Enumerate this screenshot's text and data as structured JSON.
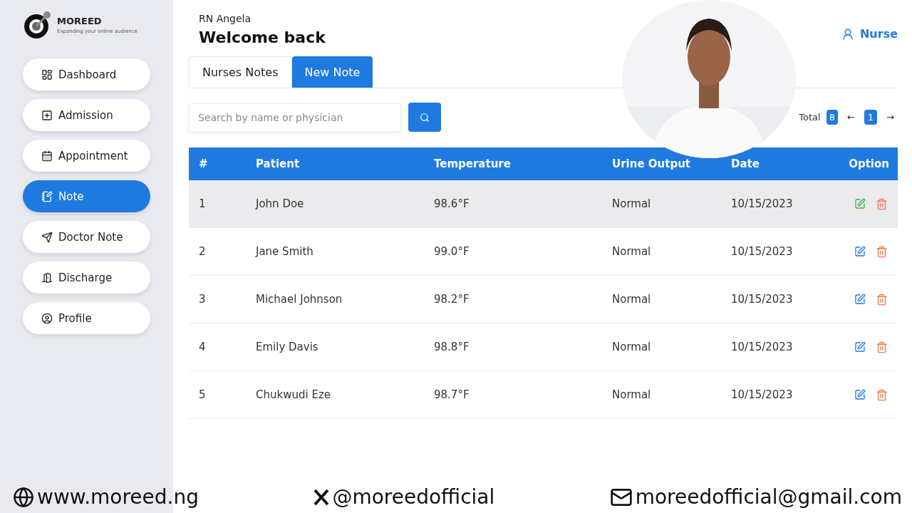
{
  "brand": {
    "name": "MOREED",
    "tagline": "Expanding your online audience"
  },
  "nav": [
    {
      "label": "Dashboard",
      "kind": "dashboard",
      "selected": false
    },
    {
      "label": "Admission",
      "kind": "admission",
      "selected": false
    },
    {
      "label": "Appointment",
      "kind": "calendar",
      "selected": false
    },
    {
      "label": "Note",
      "kind": "note",
      "selected": true
    },
    {
      "label": "Doctor Note",
      "kind": "send",
      "selected": false
    },
    {
      "label": "Discharge",
      "kind": "door",
      "selected": false
    },
    {
      "label": "Profile",
      "kind": "user",
      "selected": false
    }
  ],
  "header": {
    "user": "RN Angela",
    "greeting": "Welcome back",
    "role": "Nurse"
  },
  "tabs": [
    {
      "label": "Nurses Notes",
      "selected": false
    },
    {
      "label": "New Note",
      "selected": true
    }
  ],
  "search": {
    "placeholder": "Search by name or physician"
  },
  "pagination": {
    "label": "Total",
    "total": "8",
    "prev": "←",
    "page": "1",
    "next": "→"
  },
  "table": {
    "columns": [
      "#",
      "Patient",
      "Temperature",
      "Urine Output",
      "Date",
      "Option"
    ],
    "rows": [
      {
        "cells": [
          "1",
          "John Doe",
          "98.6°F",
          "Normal",
          "10/15/2023"
        ],
        "highlighted": true
      },
      {
        "cells": [
          "2",
          "Jane Smith",
          "99.0°F",
          "Normal",
          "10/15/2023"
        ],
        "highlighted": false
      },
      {
        "cells": [
          "3",
          "Michael Johnson",
          "98.2°F",
          "Normal",
          "10/15/2023"
        ],
        "highlighted": false
      },
      {
        "cells": [
          "4",
          "Emily Davis",
          "98.8°F",
          "Normal",
          "10/15/2023"
        ],
        "highlighted": false
      },
      {
        "cells": [
          "5",
          "Chukwudi Eze",
          "98.7°F",
          "Normal",
          "10/15/2023"
        ],
        "highlighted": false
      }
    ]
  },
  "footer": [
    {
      "kind": "web",
      "text": "www.moreed.ng"
    },
    {
      "kind": "x",
      "text": "@moreedofficial"
    },
    {
      "kind": "mail",
      "text": "moreedofficial@gmail.com"
    }
  ]
}
